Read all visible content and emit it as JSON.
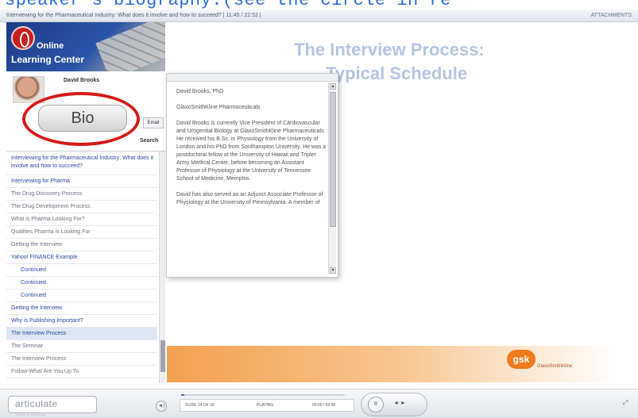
{
  "caption": "speaker's biography.(see the circle in re",
  "window": {
    "title": "Interviewing for the Pharmaceutical Industry: What does it involve and how to succeed?  |  11:45 / 22:52 |",
    "attachments": "ATTACHMENTS"
  },
  "sidebar": {
    "logo_line1": "Online",
    "logo_line2": "Learning Center",
    "presenter_name": "David Brooks",
    "bio_button": "Bio",
    "email_button": "Email",
    "search_button": "Search",
    "outline_items": [
      "Interviewing for the Pharmaceutical Industry: What does it involve and how to succeed?",
      "Interviewing for Pharma",
      "The Drug Discovery Process",
      "The Drug Development Process",
      "What is Pharma Looking For?",
      "Qualities Pharma is Looking For",
      "Getting the Interview",
      "Yahoo! FINANCE Example",
      "Continued",
      "Continued",
      "Continued",
      "Getting the Interview",
      "Why is Publishing Important?",
      "The Interview Process",
      "The Seminar",
      "The Interview Process",
      "Follow-What Are You Up To"
    ]
  },
  "slide": {
    "title_line1": "The Interview Process:",
    "title_line2": "Typical Schedule",
    "brand_badge": "gsk",
    "brand_name": "GlaxoSmithKline"
  },
  "bio_popup": {
    "paragraphs": [
      "David Brooks, PhD",
      "GlaxoSmithKline Pharmaceuticals",
      "David Brooks is currently Vice President of Cardiovascular and Urogenital Biology at GlaxoSmithKline Pharmaceuticals. He received his B.Sc. in Physiology from the University of London and his PhD from Southampton University. He was a postdoctoral fellow at the University of Hawaii and Tripler Army Medical Center, before becoming an Assistant Professor of Physiology at the University of Tennessee School of Medicine, Memphis.",
      "David has also served as an Adjunct Associate Professor of Physiology at the University of Pennsylvania. A member of"
    ]
  },
  "player": {
    "logo": "articulate",
    "logo_sub": "RAPID E-LEARNING",
    "slide_counter": "SLIDE 14 OF 30",
    "state": "PLAYING",
    "time": "00:00 / 02:06",
    "progress_percent": 2,
    "play_glyph": "II",
    "nav_glyph": "◄ ►",
    "volume_glyph": "◄)",
    "expand_glyph": "⤢"
  }
}
